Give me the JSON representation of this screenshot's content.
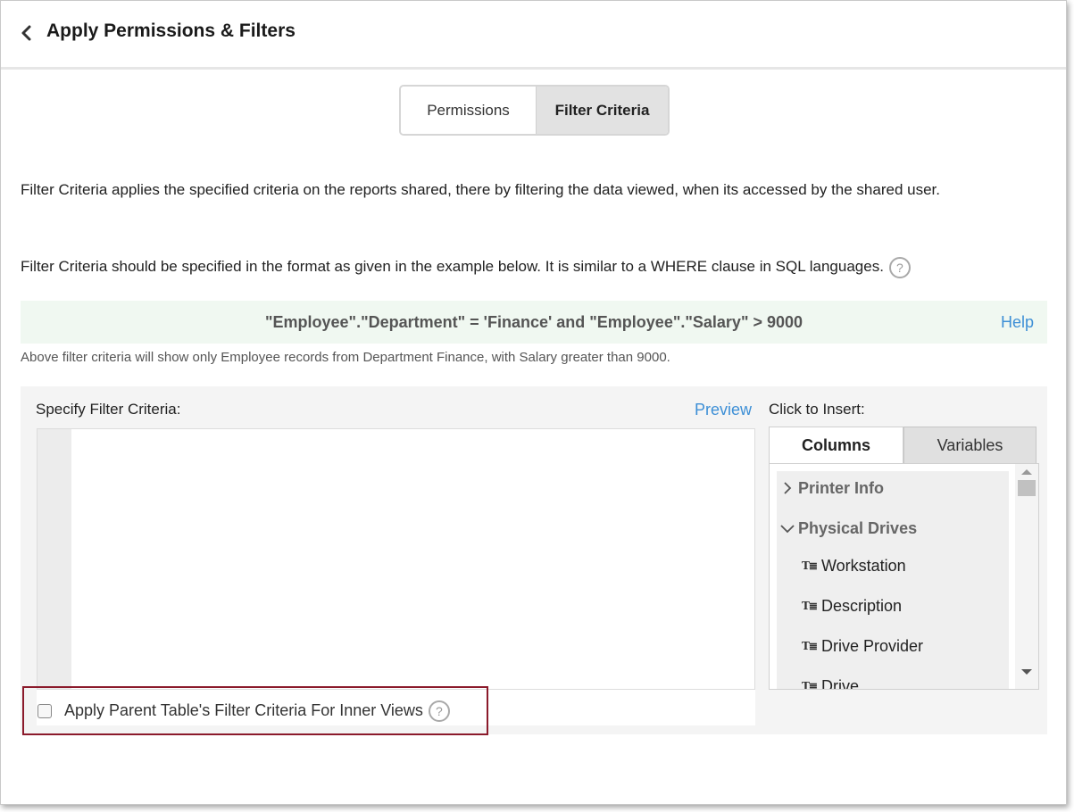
{
  "header": {
    "title": "Apply Permissions & Filters"
  },
  "tabs": [
    {
      "label": "Permissions",
      "active": false
    },
    {
      "label": "Filter Criteria",
      "active": true
    }
  ],
  "description": {
    "line1": "Filter Criteria applies the specified criteria on the reports shared, there by filtering the data viewed, when its accessed by the shared user.",
    "line2": "Filter Criteria should be specified in the format as given in the example below. It is similar to a WHERE clause in SQL languages.",
    "help_symbol": "?"
  },
  "example": {
    "criteria": "\"Employee\".\"Department\" = 'Finance' and \"Employee\".\"Salary\" > 9000",
    "help_link": "Help",
    "note": "Above filter criteria will show only Employee records from Department Finance, with Salary greater than 9000."
  },
  "editor": {
    "label": "Specify Filter Criteria:",
    "preview_link": "Preview",
    "value": ""
  },
  "insert": {
    "label": "Click to Insert:",
    "tabs": [
      "Columns",
      "Variables"
    ],
    "active_tab": "Columns",
    "groups": [
      {
        "name": "Printer Info",
        "expanded": false
      },
      {
        "name": "Physical Drives",
        "expanded": true
      }
    ],
    "columns": [
      "Workstation",
      "Description",
      "Drive Provider",
      "Drive"
    ],
    "column_icon": "T≣"
  },
  "parent_filter": {
    "label": "Apply Parent Table's Filter Criteria For Inner Views",
    "checked": false,
    "help_symbol": "?"
  },
  "colors": {
    "accent_link": "#3d8fd6",
    "highlight_border": "#8b1a2b",
    "example_bg": "#f0f8f1"
  }
}
